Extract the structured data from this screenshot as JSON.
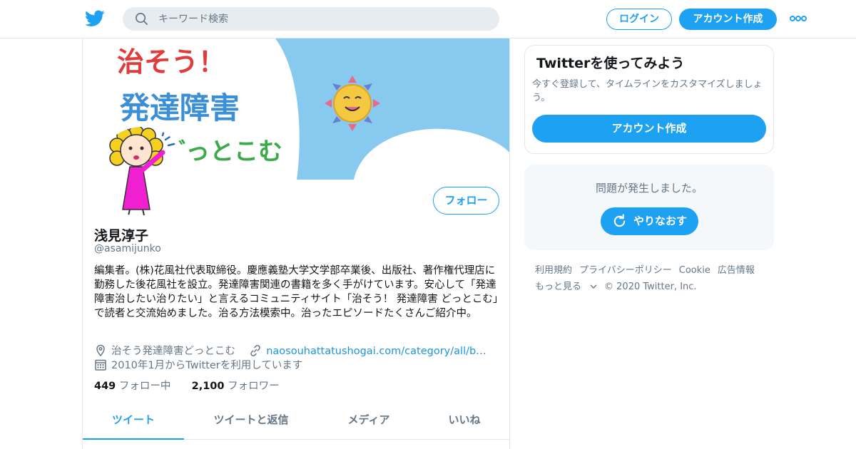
{
  "header": {
    "logo_icon": "twitter-bird-icon",
    "search_placeholder": "キーワード検索",
    "login_label": "ログイン",
    "signup_label": "アカウント作成",
    "more_icon": "more-dots-icon"
  },
  "colors": {
    "accent": "#1da1f2",
    "text_primary": "#14171a",
    "text_secondary": "#657786",
    "banner_sky": "#87c9ef"
  },
  "profile": {
    "name": "浅見淳子",
    "handle": "@asamijunko",
    "follow_label": "フォロー",
    "bio": "編集者。(株)花風社代表取締役。慶應義塾大学文学部卒業後、出版社、著作権代理店に勤務した後花風社を設立。発達障害関連の書籍を多く手がけています。安心して「発達障害治したい治りたい」と言えるコミュニティサイト「治そう！ 発達障害 どっとこむ」で読者と交流始めました。治る方法模索中。治ったエピソードたくさんご紹介中。",
    "location": "治そう発達障害どっとこむ",
    "url": "naosouhattatushogai.com/category/all/b…",
    "joined": "2010年1月からTwitterを利用しています",
    "following_count": "449",
    "following_label": "フォロー中",
    "followers_count": "2,100",
    "followers_label": "フォロワー",
    "banner_text": "治そう！発達障害どっとこむ"
  },
  "tabs": [
    {
      "label": "ツイート",
      "active": true
    },
    {
      "label": "ツイートと返信",
      "active": false
    },
    {
      "label": "メディア",
      "active": false
    },
    {
      "label": "いいね",
      "active": false
    }
  ],
  "signup_card": {
    "title": "Twitterを使ってみよう",
    "description": "今すぐ登録して、タイムラインをカスタマイズしましょう。",
    "button_label": "アカウント作成"
  },
  "error_card": {
    "message": "問題が発生しました。",
    "retry_label": "やりなおす"
  },
  "footer": {
    "links": [
      "利用規約",
      "プライバシーポリシー",
      "Cookie",
      "広告情報"
    ],
    "more_label": "もっと見る",
    "copyright": "© 2020 Twitter, Inc."
  }
}
